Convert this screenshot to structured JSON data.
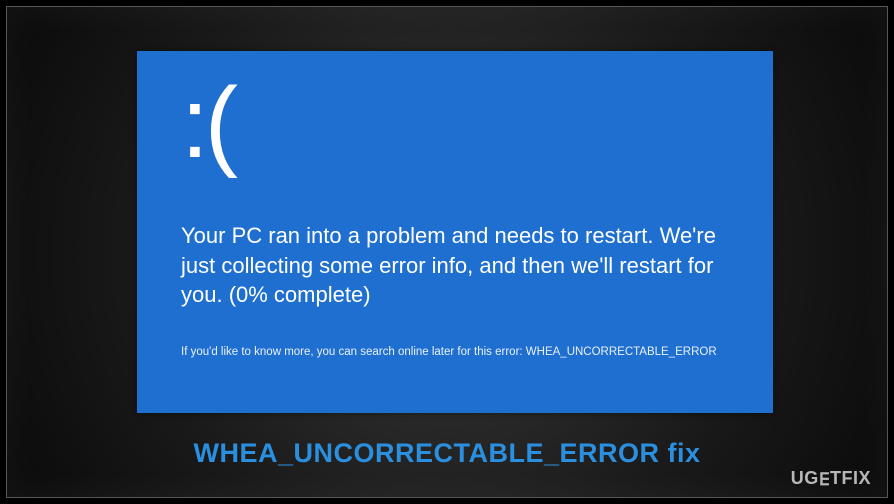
{
  "bsod": {
    "sadface": ":(",
    "message": "Your PC ran into a problem and needs to restart. We're just collecting some error info, and then we'll restart for you. (0% complete)",
    "hint": "If you'd like to know more, you can search online later for this error: WHEA_UNCORRECTABLE_ERROR"
  },
  "caption": "WHEA_UNCORRECTABLE_ERROR fix",
  "watermark": {
    "part1": "UG",
    "part2": "∃",
    "part3": "TFIX"
  },
  "colors": {
    "bsod_bg": "#1f6fd0",
    "caption_color": "#2b8fe0",
    "frame_bg": "#1a1a1a"
  }
}
